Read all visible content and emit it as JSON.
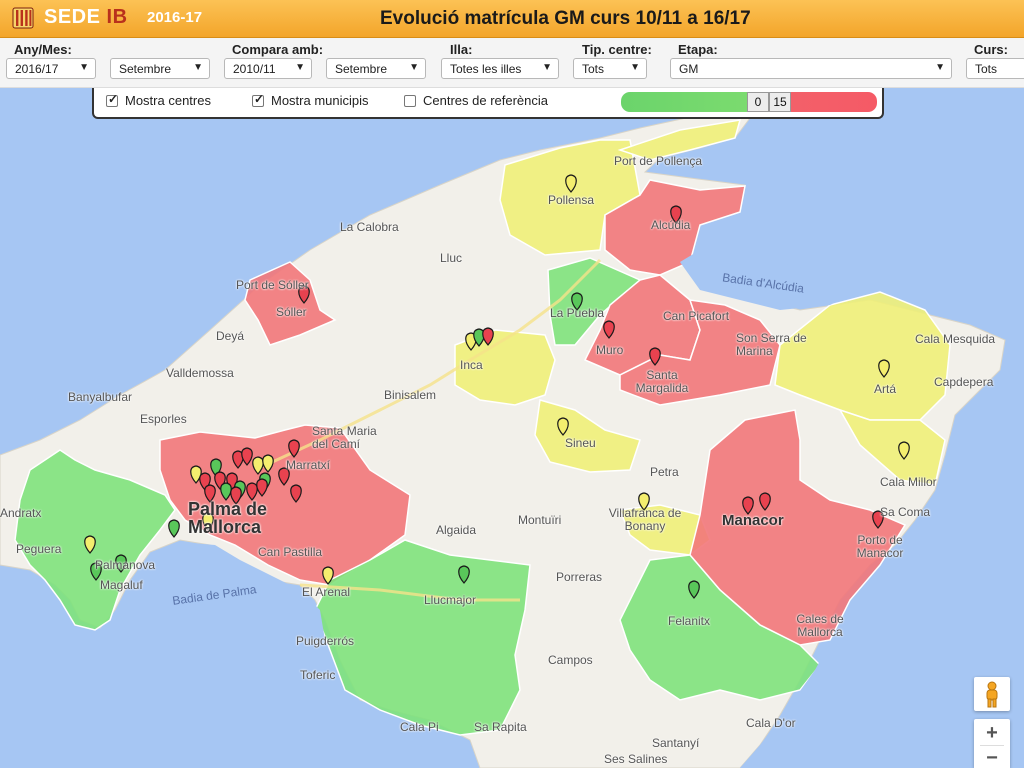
{
  "header": {
    "brand_part1": "SEDE ",
    "brand_part2": "IB",
    "year": "2016-17",
    "title": "Evolució matrícula GM curs 10/11 a 16/17"
  },
  "filters": {
    "any_mes": {
      "label": "Any/Mes:",
      "value": "2016/17",
      "month": "Setembre"
    },
    "compara": {
      "label": "Compara amb:",
      "value": "2010/11",
      "month": "Setembre"
    },
    "illa": {
      "label": "Illa:",
      "value": "Totes les illes"
    },
    "tip_centre": {
      "label": "Tip. centre:",
      "value": "Tots"
    },
    "etapa": {
      "label": "Etapa:",
      "value": "GM"
    },
    "curs": {
      "label": "Curs:",
      "value": "Tots"
    }
  },
  "controls": {
    "mostra_centres": {
      "label": "Mostra centres",
      "checked": true
    },
    "mostra_municipis": {
      "label": "Mostra municipis",
      "checked": true
    },
    "centres_referencia": {
      "label": "Centres de referència",
      "checked": false
    },
    "range_low": "0",
    "range_high": "15"
  },
  "map": {
    "colors": {
      "sea": "#a6c6f3",
      "land": "#f2f0ea",
      "green": "#7fe27c",
      "red": "#f2777a",
      "yellow": "#f0ef79"
    },
    "towns": [
      "Port de Pollença",
      "Pollensa",
      "Alcúdia",
      "La Calobra",
      "Lluc",
      "Port de Sóller",
      "Sóller",
      "Deyá",
      "Valldemossa",
      "Banyalbufar",
      "Esporles",
      "Inca",
      "Binisalem",
      "La Puebla",
      "Can Picafort",
      "Son Serra de Marina",
      "Muro",
      "Santa Margalida",
      "Cala Mesquida",
      "Capdepera",
      "Artá",
      "Cala Millor",
      "Sa Coma",
      "Santa Maria del Camí",
      "Marratxí",
      "Sineu",
      "Petra",
      "Palma de Mallorca",
      "Andratx",
      "Peguera",
      "Palmanova",
      "Magaluf",
      "Can Pastilla",
      "El Arenal",
      "Algaida",
      "Montuïri",
      "Villafranca de Bonany",
      "Manacor",
      "Porto de Manacor",
      "Porreras",
      "Llucmajor",
      "Felanitx",
      "Cales de Mallorca",
      "Puigderrós",
      "Toferic",
      "Campos",
      "Cala Pi",
      "Sa Rapita",
      "Santanyí",
      "Cala D'or",
      "Ses Salines"
    ],
    "seas": [
      "Badia d'Alcúdia",
      "Badia de Palma"
    ]
  }
}
